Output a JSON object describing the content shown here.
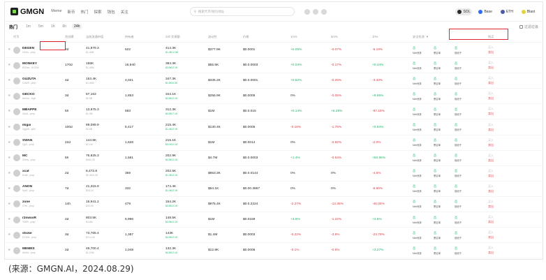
{
  "topbar": {
    "logo": "GMGN",
    "nav": [
      "Meme",
      "新币",
      "热门",
      "探索",
      "钱包",
      "关注"
    ],
    "search_placeholder": "搜索代币/钱包地址",
    "chains": [
      {
        "name": "SOL",
        "color": "#2b2b2b",
        "active": true
      },
      {
        "name": "Base",
        "color": "#2f6bf6",
        "active": false
      },
      {
        "name": "ETH",
        "color": "#4b5aa8",
        "active": false
      },
      {
        "name": "Blast",
        "color": "#e5d33a",
        "active": false
      }
    ]
  },
  "subbar": {
    "title": "热门",
    "timeframes": [
      "1m",
      "5m",
      "1h",
      "6h",
      "24h"
    ],
    "active_timeframe": "24h",
    "right_label": "过滤垃圾"
  },
  "headers": {
    "token": "代币",
    "age": "池创建",
    "cap": "当前流通市值",
    "holders": "持有者",
    "vol": "24h 交易额",
    "liq": "流动性",
    "price": "价格",
    "ch1": "1m%",
    "ch2": "5m%",
    "ch3": "1h%",
    "audit": "安全检测",
    "buy": "购买"
  },
  "rows": [
    {
      "name": "DEGEN",
      "sub": "C6Gu...pmp",
      "age": "2d",
      "cap": "41,879.3",
      "cap2": "$1.46B",
      "holders": "522",
      "vol": "414.3K",
      "vol2": "$1.4K/1.1M",
      "liq": "$377.9K",
      "price": "$0.0001",
      "ch1": "+0.05%",
      "ch2": "-0.07%",
      "ch3": "-5.19%",
      "ch1c": "up",
      "ch2c": "down",
      "ch3c": "down"
    },
    {
      "name": "MONKEY",
      "sub": "B2Ses...9GGM",
      "age": "170d",
      "cap": "155K",
      "cap2": "$1.48M",
      "holders": "16,940",
      "vol": "384.3K",
      "vol2": "$3.5K/2.1K",
      "liq": "$55.5K",
      "price": "$0.0.0003",
      "ch1": "+0.04%",
      "ch2": "-0.17%",
      "ch3": "+0.44%",
      "ch1c": "up",
      "ch2c": "down",
      "ch3c": "up"
    },
    {
      "name": "GUZUTA",
      "sub": "CdWP...pmp",
      "age": "4d",
      "cap": "153.4K",
      "cap2": "$1.46M",
      "holders": "4,021",
      "vol": "347.3K",
      "vol2": "$1.5K/0.3K",
      "liq": "$335.2K",
      "price": "$0.0.0001",
      "ch1": "+0.52%",
      "ch2": "-0.26%",
      "ch3": "-3.33%",
      "ch1c": "up",
      "ch2c": "down",
      "ch3c": "down"
    },
    {
      "name": "GECKO",
      "sub": "6wGm...Kgif",
      "age": "3d",
      "cap": "57,163",
      "cap2": "$0.5B",
      "holders": "1,853",
      "vol": "344.1K",
      "vol2": "$4.6K/2.1K",
      "liq": "$256.9K",
      "price": "$0.0005",
      "ch1": "0%",
      "ch2": "-0.05%",
      "ch3": "+9.65%",
      "ch1c": "flat",
      "ch2c": "down",
      "ch3c": "up"
    },
    {
      "name": "MBAPPE",
      "sub": "2kw4...pmp",
      "age": "5h",
      "cap": "13,975.3",
      "cap2": "$1.3M",
      "holders": "583",
      "vol": "312.3K",
      "vol2": "$4.6K/7.1K",
      "liq": "$1M",
      "price": "$0.0.015",
      "ch1": "+0.14%",
      "ch2": "+6.28%",
      "ch3": "-97.15%",
      "ch1c": "up",
      "ch2c": "up",
      "ch3c": "down"
    },
    {
      "name": "ikigai",
      "sub": "2gg38...gbS",
      "age": "100d",
      "cap": "89,089.9",
      "cap2": "$4.6B",
      "holders": "5,417",
      "vol": "215.4K",
      "vol2": "$1.4K/2.1K",
      "liq": "$130.4K",
      "price": "$0.0005",
      "ch1": "-0.16%",
      "ch2": "-1.75%",
      "ch3": "+0.94%",
      "ch1c": "down",
      "ch2c": "down",
      "ch3c": "up"
    },
    {
      "name": "SWAN",
      "sub": "2jpX...pmp",
      "age": "22d",
      "cap": "144.5K",
      "cap2": "$1.1M",
      "holders": "1,626",
      "vol": "215.1K",
      "vol2": "$3.1K/2.1K",
      "liq": "$1M",
      "price": "$0.0014",
      "ch1": "0%",
      "ch2": "-0.92%",
      "ch3": "-2.0%",
      "ch1c": "flat",
      "ch2c": "down",
      "ch3c": "down"
    },
    {
      "name": "MC",
      "sub": "2Hmy...pmp",
      "age": "5h",
      "cap": "76,825.3",
      "cap2": "$460.3K",
      "holders": "1,561",
      "vol": "202.9K",
      "vol2": "$4.5K/2.1K",
      "liq": "$4.7M",
      "price": "$0.0.0003",
      "ch1": "+1.4%",
      "ch2": "-0.54%",
      "ch3": "+50.95%",
      "ch1c": "up",
      "ch2c": "down",
      "ch3c": "up"
    },
    {
      "name": "xcat",
      "sub": "8xa6...pmp",
      "age": "2d",
      "cap": "8,472.8",
      "cap2": "$0.4K/0.2K",
      "holders": "359",
      "vol": "202.5K",
      "vol2": "$1.3K/2.1K",
      "liq": "$853.3K",
      "price": "$0.0.0144",
      "ch1": "0%",
      "ch2": "0%",
      "ch3": "-4.5%",
      "ch1c": "flat",
      "ch2c": "flat",
      "ch3c": "down"
    },
    {
      "name": "ANON",
      "sub": "9yz4...pmp",
      "age": "7d",
      "cap": "21,315.9",
      "cap2": "$15.1K",
      "holders": "332",
      "vol": "174.4K",
      "vol2": "$1.4K/2.1K",
      "liq": "$54.1K",
      "price": "$0.00.3867",
      "ch1": "0%",
      "ch2": "0%",
      "ch3": "-6.86%",
      "ch1c": "flat",
      "ch2c": "flat",
      "ch3c": "down"
    },
    {
      "name": "zone",
      "sub": "4Trh...pmp",
      "age": "14h",
      "cap": "16,941.2",
      "cap2": "$33.9K",
      "holders": "479",
      "vol": "154.2K",
      "vol2": "$4.6K/2.1K",
      "liq": "$975.4K",
      "price": "$0.0.2224",
      "ch1": "-2.27%",
      "ch2": "-13.35%",
      "ch3": "-46.05%",
      "ch1c": "down",
      "ch2c": "down",
      "ch3c": "down"
    },
    {
      "name": "r2swoxR",
      "sub": "YMfR...pmp",
      "age": "2d",
      "cap": "803.5K",
      "cap2": "$4.8M",
      "holders": "5,996",
      "vol": "148.5K",
      "vol2": "$4.5K/2.1K",
      "liq": "$1M",
      "price": "$0.0159",
      "ch1": "+3.5%",
      "ch2": "-1.22%",
      "ch3": "+3.6%",
      "ch1c": "up",
      "ch2c": "down",
      "ch3c": "up"
    },
    {
      "name": "sticke",
      "sub": "DYMH...pmp",
      "age": "3d",
      "cap": "73,765.4",
      "cap2": "$714.4K",
      "holders": "1,387",
      "vol": "143K",
      "vol2": "$4.5K/2.1K",
      "liq": "$1.4M",
      "price": "$0.0003",
      "ch1": "-0.22%",
      "ch2": "-3.9%",
      "ch3": "-23.79%",
      "ch1c": "down",
      "ch2c": "down",
      "ch3c": "down"
    },
    {
      "name": "MEMES",
      "sub": "Akhfd...pmp",
      "age": "2d",
      "cap": "49,700.4",
      "cap2": "$1.24M",
      "holders": "1,048",
      "vol": "132.3K",
      "vol2": "$4.5K/2.1K",
      "liq": "$12.8K",
      "price": "$0.0006",
      "ch1": "-0.1%",
      "ch2": "-0.6%",
      "ch3": "+3.27%",
      "ch1c": "down",
      "ch2c": "down",
      "ch3c": "up"
    }
  ],
  "audit": {
    "ok": "否",
    "labels": [
      "Mint丢弃",
      "黑名单",
      "烧池子"
    ]
  },
  "buy": {
    "a": "买入",
    "b": "卖出"
  },
  "caption": "(来源：GMGN.AI，2024.08.29)"
}
